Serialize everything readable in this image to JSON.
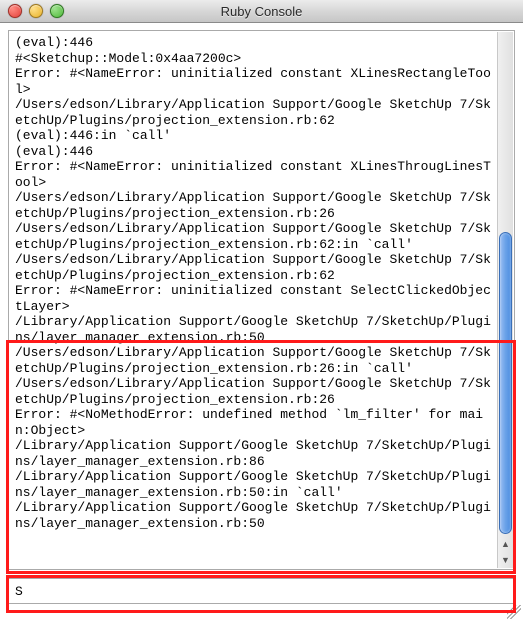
{
  "window": {
    "title": "Ruby Console"
  },
  "console": {
    "output": "(eval):446\n#<Sketchup::Model:0x4aa7200c>\nError: #<NameError: uninitialized constant XLinesRectangleTool>\n/Users/edson/Library/Application Support/Google SketchUp 7/SketchUp/Plugins/projection_extension.rb:62\n(eval):446:in `call'\n(eval):446\nError: #<NameError: uninitialized constant XLinesThrougLinesTool>\n/Users/edson/Library/Application Support/Google SketchUp 7/SketchUp/Plugins/projection_extension.rb:26\n/Users/edson/Library/Application Support/Google SketchUp 7/SketchUp/Plugins/projection_extension.rb:62:in `call'\n/Users/edson/Library/Application Support/Google SketchUp 7/SketchUp/Plugins/projection_extension.rb:62\nError: #<NameError: uninitialized constant SelectClickedObjectLayer>\n/Library/Application Support/Google SketchUp 7/SketchUp/Plugins/layer_manager_extension.rb:50\n/Users/edson/Library/Application Support/Google SketchUp 7/SketchUp/Plugins/projection_extension.rb:26:in `call'\n/Users/edson/Library/Application Support/Google SketchUp 7/SketchUp/Plugins/projection_extension.rb:26\nError: #<NoMethodError: undefined method `lm_filter' for main:Object>\n/Library/Application Support/Google SketchUp 7/SketchUp/Plugins/layer_manager_extension.rb:86\n/Library/Application Support/Google SketchUp 7/SketchUp/Plugins/layer_manager_extension.rb:50:in `call'\n/Library/Application Support/Google SketchUp 7/SketchUp/Plugins/layer_manager_extension.rb:50\n"
  },
  "input": {
    "value": "S"
  }
}
